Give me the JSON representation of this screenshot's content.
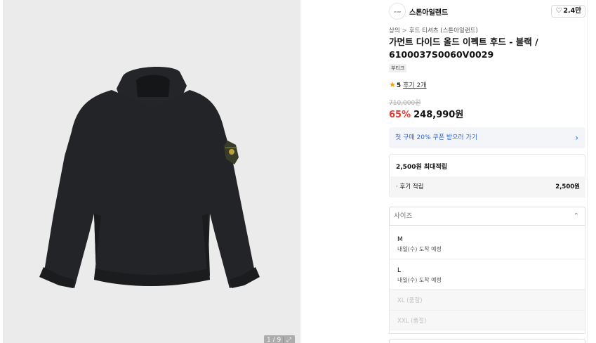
{
  "gallery": {
    "counter": "1 / 9",
    "expand_icon": "expand-icon"
  },
  "brand": {
    "logo_text": "STONE ISLAND",
    "name": "스톤아일랜드"
  },
  "like": {
    "count": "2.4만",
    "icon": "heart-icon"
  },
  "breadcrumb": {
    "level1": "상의",
    "separator": ">",
    "level2": "후드 티셔츠 (스톤아일랜드)"
  },
  "product": {
    "title": "가먼트 다이드 올드 이펙트 후드 - 블랙 / 6100037S0060V0029",
    "tag": "부티크"
  },
  "rating": {
    "score": "5",
    "reviews": "후기 2개"
  },
  "price": {
    "original": "710,000원",
    "discount": "65%",
    "sale": "248,990원"
  },
  "coupon": {
    "label": "첫 구매 20% 쿠폰 받으러 가기"
  },
  "points": {
    "title": "2,500원 최대적립",
    "row_label": "· 후기 적립",
    "row_value": "2,500원"
  },
  "size_select": {
    "placeholder": "사이즈"
  },
  "size_options": [
    {
      "name": "M",
      "eta": "내일(수) 도착 예정",
      "soldout": false
    },
    {
      "name": "L",
      "eta": "내일(수) 도착 예정",
      "soldout": false
    },
    {
      "name": "XL (품절)",
      "eta": "",
      "soldout": true
    },
    {
      "name": "XXL (품절)",
      "eta": "",
      "soldout": true
    }
  ],
  "colors": {
    "discount": "#e53b2f",
    "coupon": "#2b64e0",
    "star": "#f7a600"
  }
}
